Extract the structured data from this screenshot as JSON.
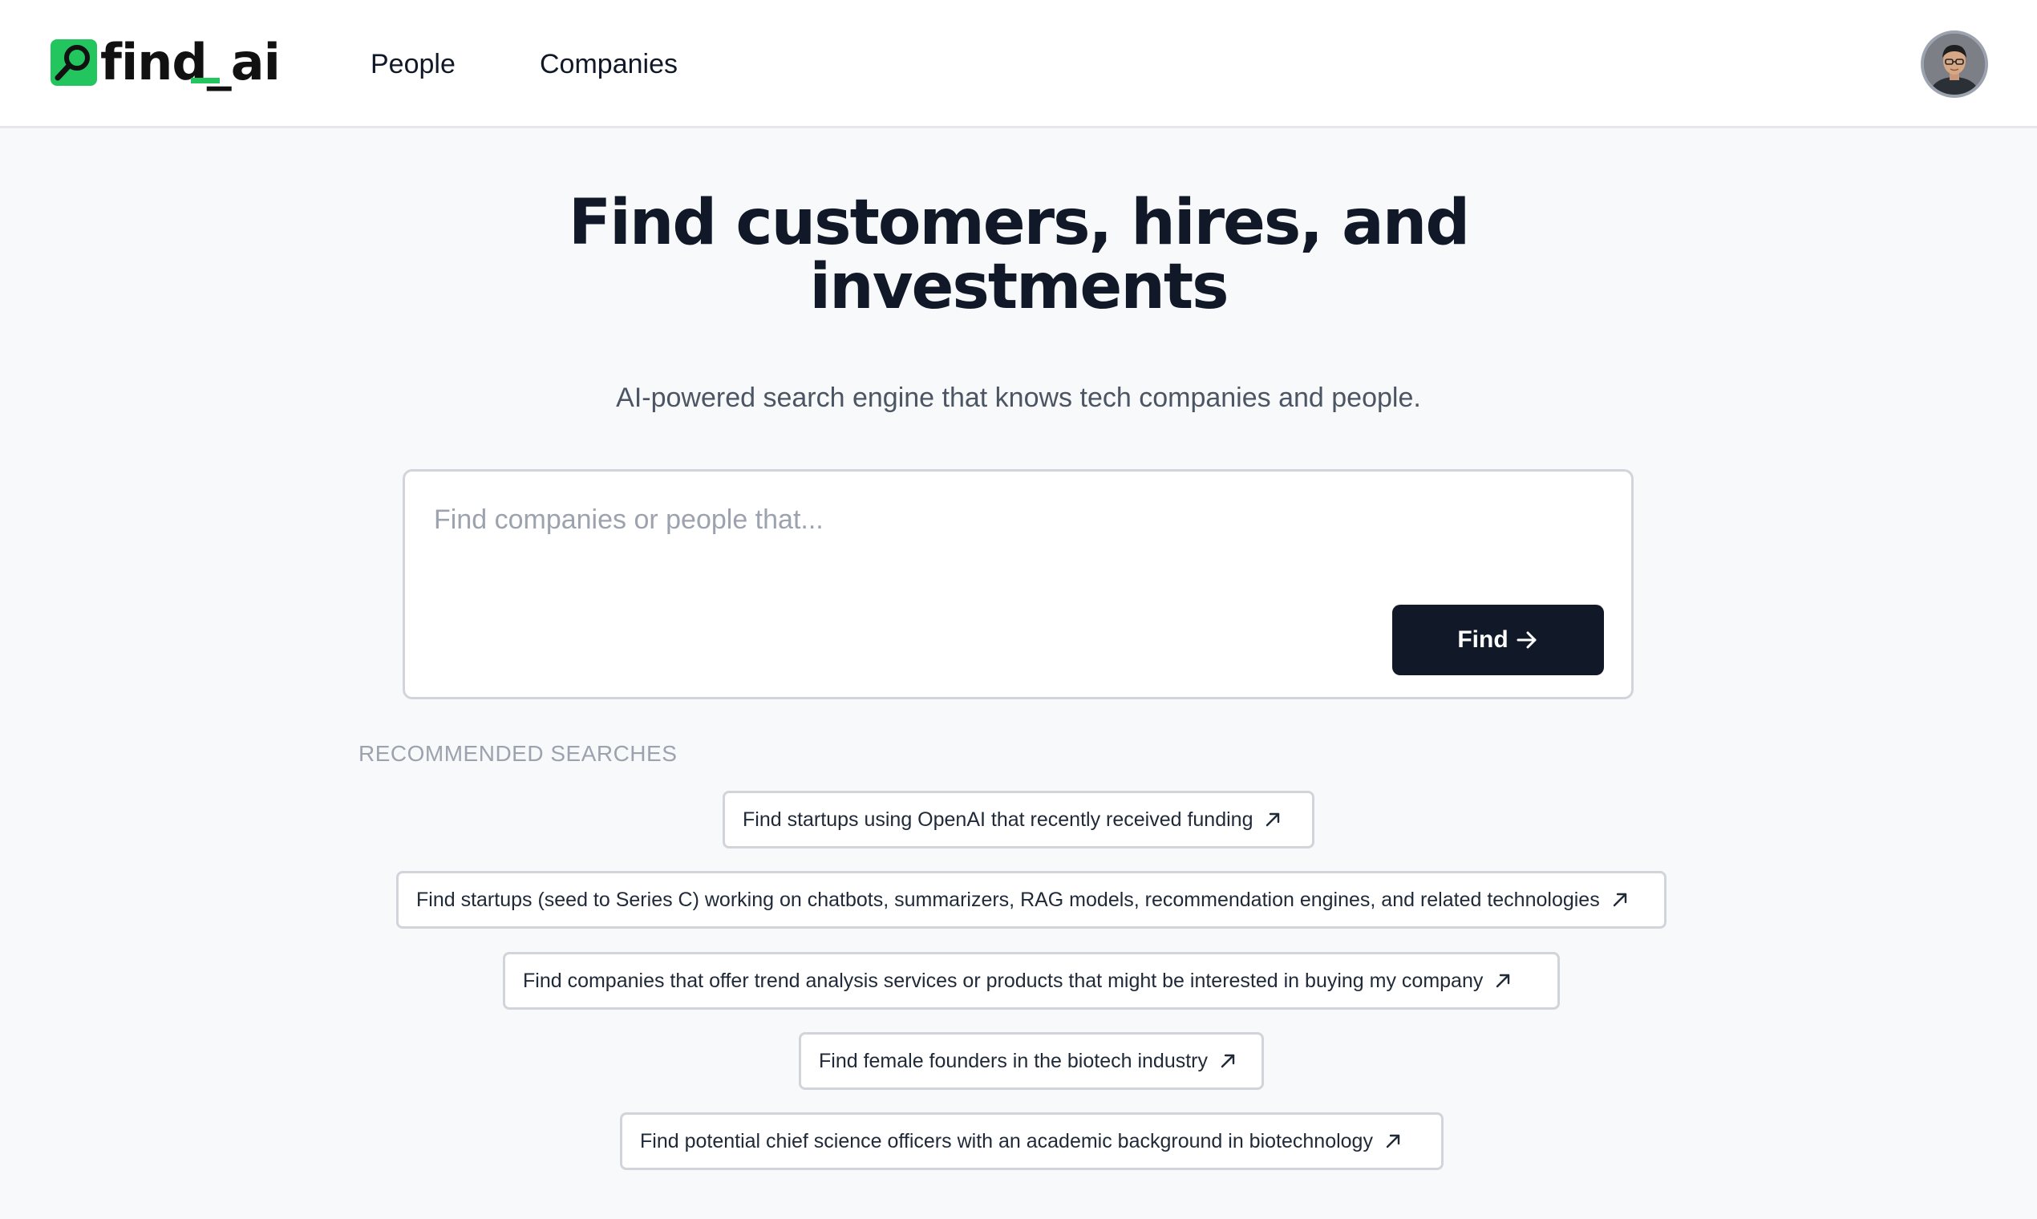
{
  "header": {
    "logo_text": "find_ai",
    "nav": [
      {
        "label": "People"
      },
      {
        "label": "Companies"
      }
    ]
  },
  "hero": {
    "title_line1": "Find customers, hires, and",
    "title_line2": "investments",
    "subtitle": "AI-powered search engine that knows tech companies and people."
  },
  "search": {
    "placeholder": "Find companies or people that...",
    "value": "",
    "button_label": "Find"
  },
  "recommended": {
    "label": "RECOMMENDED SEARCHES",
    "items": [
      {
        "label": "Find startups using OpenAI that recently received funding"
      },
      {
        "label": "Find startups (seed to Series C) working on chatbots, summarizers, RAG models, recommendation engines, and related technologies"
      },
      {
        "label": "Find companies that offer trend analysis services or products that might be interested in buying my company"
      },
      {
        "label": "Find female founders in the biotech industry"
      },
      {
        "label": "Find potential chief science officers with an academic background in biotechnology"
      }
    ]
  },
  "colors": {
    "accent": "#22c55e",
    "primary_dark": "#111827",
    "background": "#f8f9fa"
  },
  "icons": {
    "logo": "magnifier-icon",
    "button": "arrow-right-icon",
    "chip": "arrow-up-right-icon"
  }
}
